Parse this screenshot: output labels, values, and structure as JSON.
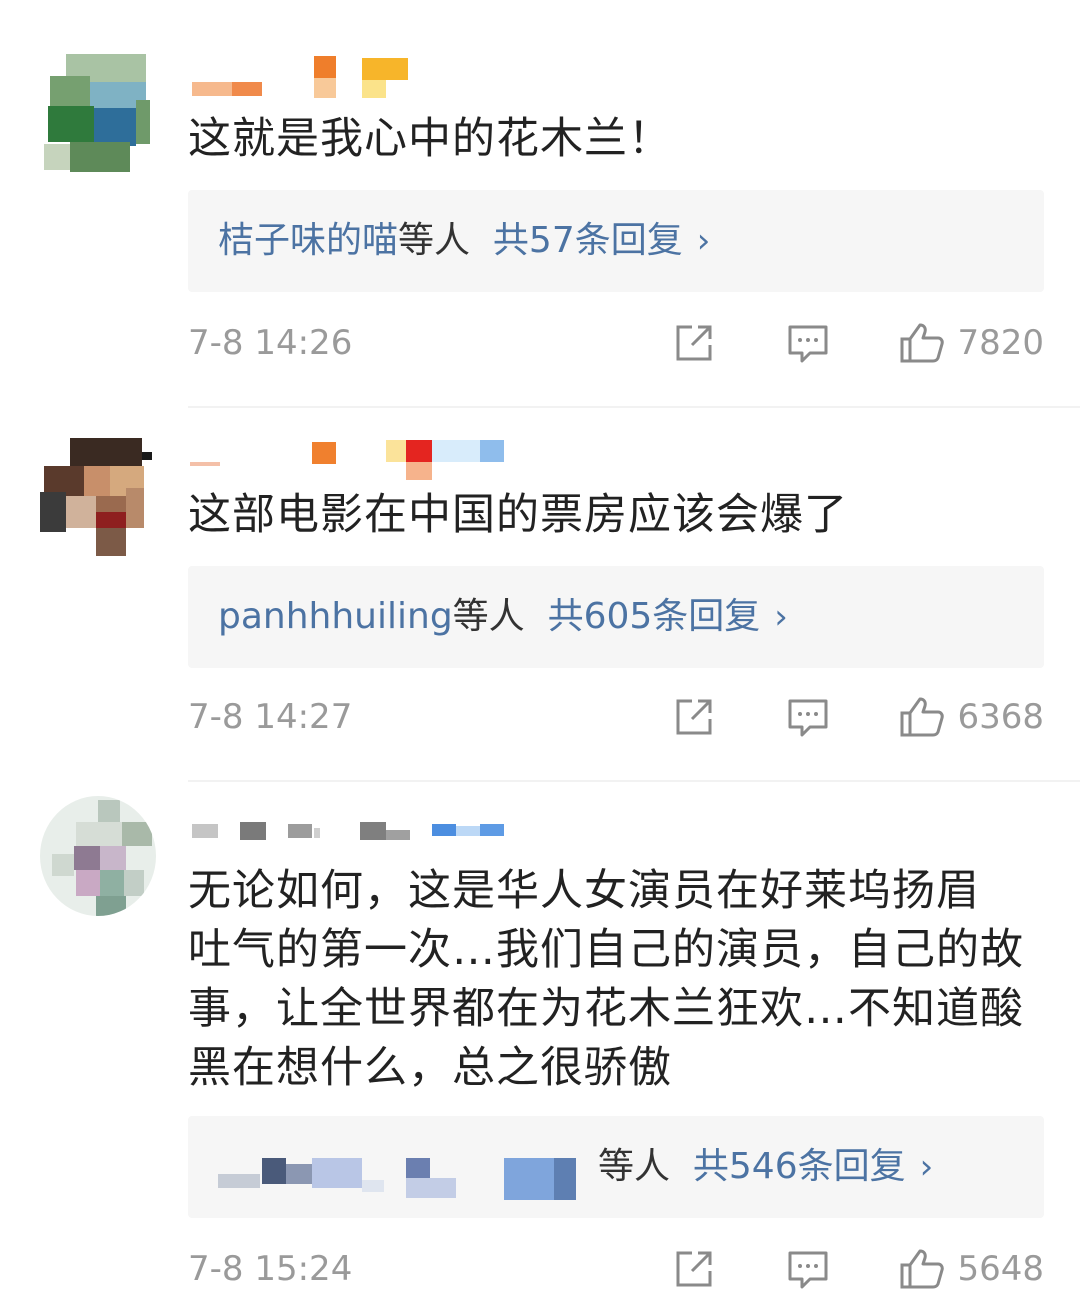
{
  "comments": [
    {
      "text": "这就是我心中的花木兰！",
      "reply_prefix": "桔子味的喵",
      "reply_mid": "等人",
      "reply_count": "共57条回复",
      "time": "7-8 14:26",
      "likes": "7820"
    },
    {
      "text": "这部电影在中国的票房应该会爆了",
      "reply_prefix": "panhhhuiling",
      "reply_mid": "等人",
      "reply_count": "共605条回复",
      "time": "7-8 14:27",
      "likes": "6368"
    },
    {
      "text_lines": [
        "无论如何，这是华人女演员在好莱坞扬眉",
        "吐气的第一次…我们自己的演员，自己的故",
        "事，让全世界都在为花木兰狂欢…不知道酸",
        "黑在想什么，总之很骄傲"
      ],
      "reply_mid": "等人",
      "reply_count": "共546条回复",
      "time": "7-8 15:24",
      "likes": "5648"
    }
  ],
  "icons": {
    "share": "share-icon",
    "comment": "comment-icon",
    "like": "thumbs-up-icon",
    "chevron": "chevron-right-icon"
  },
  "colors": {
    "link_blue": "#4c73a3",
    "meta_gray": "#9a9a9a",
    "reply_bg": "#f6f6f6",
    "text": "#222222"
  }
}
